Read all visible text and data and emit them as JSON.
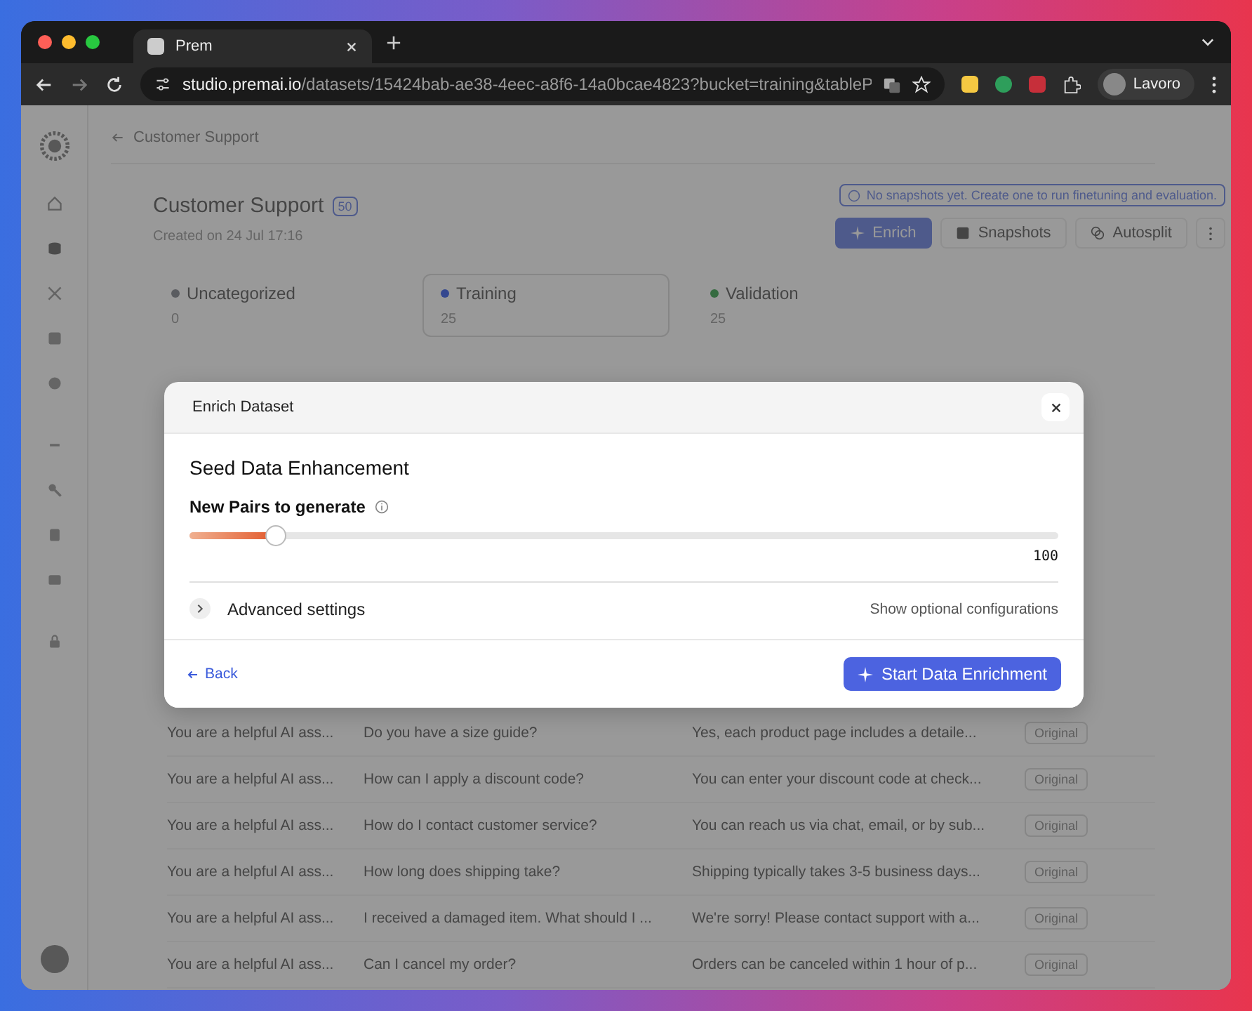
{
  "browser": {
    "tab_title": "Prem",
    "url_host": "studio.premai.io",
    "url_path": "/datasets/15424bab-ae38-4eec-a8f6-14a0bcae4823?bucket=training&tableP",
    "profile": "Lavoro"
  },
  "breadcrumb": "Customer Support",
  "header": {
    "title": "Customer Support",
    "count": "50",
    "created": "Created on 24 Jul 17:16",
    "notice": "No snapshots yet. Create one to run finetuning and evaluation."
  },
  "actions": [
    {
      "label": "Enrich",
      "kind": "primary"
    },
    {
      "label": "Snapshots",
      "kind": "snapshot"
    },
    {
      "label": "Autosplit",
      "kind": "split"
    },
    {
      "kind": "more"
    }
  ],
  "buckets": [
    {
      "name": "Uncategorized",
      "count": "0",
      "color": "#5a5c60",
      "selected": false
    },
    {
      "name": "Training",
      "count": "25",
      "color": "#34478f",
      "selected": true
    },
    {
      "name": "Validation",
      "count": "25",
      "color": "#356b40",
      "selected": false
    }
  ],
  "rows": [
    {
      "system": "You are a helpful AI ass...",
      "question": "Do you have a size guide?",
      "answer": "Yes, each product page includes a detaile...",
      "type": "Original"
    },
    {
      "system": "You are a helpful AI ass...",
      "question": "How can I apply a discount code?",
      "answer": "You can enter your discount code at check...",
      "type": "Original"
    },
    {
      "system": "You are a helpful AI ass...",
      "question": "How do I contact customer service?",
      "answer": "You can reach us via chat, email, or by sub...",
      "type": "Original"
    },
    {
      "system": "You are a helpful AI ass...",
      "question": "How long does shipping take?",
      "answer": "Shipping typically takes 3-5 business days...",
      "type": "Original"
    },
    {
      "system": "You are a helpful AI ass...",
      "question": "I received a damaged item. What should I ...",
      "answer": "We're sorry! Please contact support with a...",
      "type": "Original"
    },
    {
      "system": "You are a helpful AI ass...",
      "question": "Can I cancel my order?",
      "answer": "Orders can be canceled within 1 hour of p...",
      "type": "Original"
    }
  ],
  "modal": {
    "title": "Enrich Dataset",
    "section": "Seed Data Enhancement",
    "slider": {
      "label": "New Pairs to generate",
      "level": 0.1,
      "max_label": "100"
    },
    "advanced": {
      "label": "Advanced settings",
      "hint": "Show optional configurations",
      "expanded": false
    },
    "back": "Back",
    "submit": "Start Data Enrichment"
  }
}
